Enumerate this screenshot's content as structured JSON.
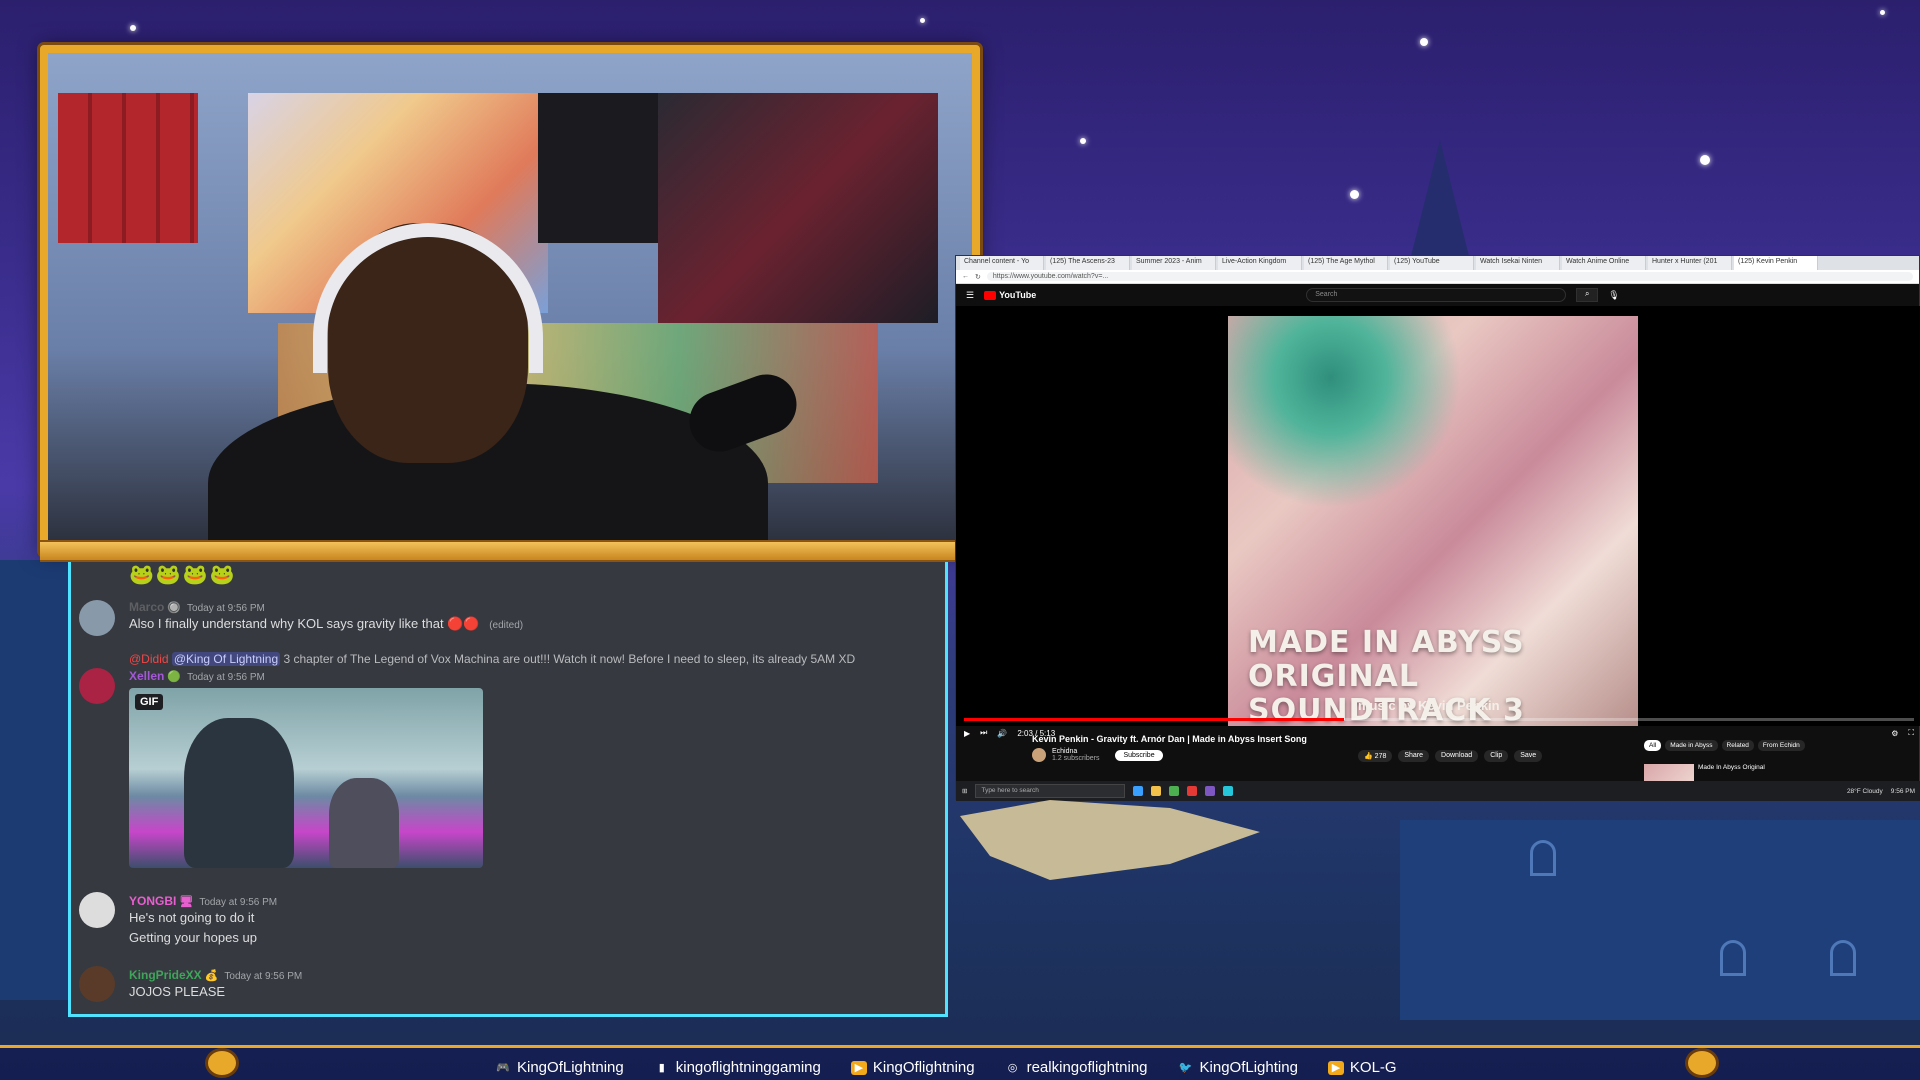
{
  "chat": {
    "messages": [
      {
        "user": "Marco",
        "badge": "🔘",
        "time": "Today at 9:56 PM",
        "text": "Also I finally understand why KOL says gravity like that",
        "emotes": "🔴🔴",
        "edited": "(edited)",
        "color": "#5d5f63"
      },
      {
        "user": "Xellen",
        "badge": "🟢",
        "time": "Today at 9:56 PM",
        "reply_user": "@Didid",
        "reply_mention": "@King Of Lightning",
        "reply_text": "3 chapter of The Legend of Vox Machina are out!!! Watch it now! Before I need to sleep, its already 5AM XD",
        "gif_label": "GIF",
        "color": "#a358d6"
      },
      {
        "user": "YONGBI",
        "badge": "🖥",
        "time": "Today at 9:56 PM",
        "lines": [
          "He's not going to do it",
          "Getting your hopes up"
        ],
        "color": "#e85fd0"
      },
      {
        "user": "KingPrideXX",
        "badge": "💰",
        "time": "Today at 9:56 PM",
        "text": "JOJOS PLEASE",
        "color": "#3fa55b"
      }
    ]
  },
  "browser": {
    "tabs": [
      "Channel content - Yo",
      "(125) The Ascens-23",
      "Summer 2023 - Anim",
      "Live-Action Kingdom",
      "(125) The Age Mythol",
      "(125) YouTube",
      "Watch Isekai Ninten",
      "Watch Anime Online",
      "Hunter x Hunter (201",
      "(125) Kevin Penkin"
    ],
    "url": "https://www.youtube.com/watch?v=...",
    "search_placeholder": "Search",
    "logo": "YouTube",
    "album_title_line1": "MADE IN ABYSS",
    "album_title_line2": "ORIGINAL SOUNDTRACK 3",
    "album_music_by": "music by Kevin Penkin",
    "time": "2:03 / 5:13",
    "progress_fraction": 0.4,
    "video_title": "Kevin Penkin - Gravity ft. Arnór Dan | Made in Abyss Insert Song",
    "channel": "Echidna",
    "subscribers": "1.2 subscribers",
    "subscribe": "Subscribe",
    "likes": "278",
    "share": "Share",
    "download": "Download",
    "clip": "Clip",
    "save": "Save",
    "chips": [
      "All",
      "Made in Abyss",
      "Related",
      "From Echidn"
    ],
    "next_title": "Made In Abyss Original",
    "taskbar_search": "Type here to search",
    "weather": "28°F Cloudy",
    "taskbar_time": "9:56 PM"
  },
  "footer": {
    "socials": [
      {
        "platform": "discord",
        "icon": "🎮",
        "handle": "KingOfLightning"
      },
      {
        "platform": "twitch",
        "icon": "▮",
        "handle": "kingoflightninggaming"
      },
      {
        "platform": "youtube",
        "icon": "▶",
        "handle": "KingOflightning"
      },
      {
        "platform": "instagram",
        "icon": "◎",
        "handle": "realkingoflightning"
      },
      {
        "platform": "twitter",
        "icon": "🐦",
        "handle": "KingOfLighting"
      },
      {
        "platform": "youtube-2",
        "icon": "▶",
        "handle": "KOL-G"
      }
    ]
  },
  "colors": {
    "accent_gold": "#e8a92a",
    "chat_bg": "#36393f",
    "yt_red": "#ff0000",
    "cyan_glow": "#4fe3ff"
  }
}
